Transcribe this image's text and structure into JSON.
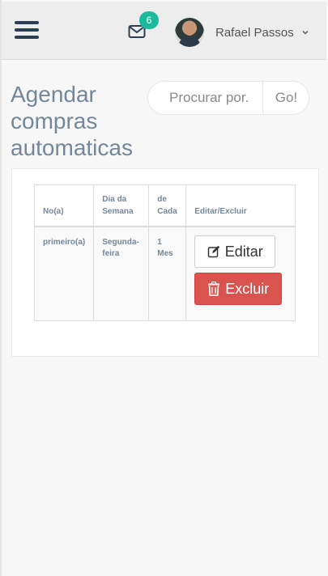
{
  "header": {
    "mail_count": "6",
    "user_name": "Rafael Passos"
  },
  "page": {
    "title": "Agendar compras automaticas"
  },
  "search": {
    "placeholder": "Procurar por.",
    "go_label": "Go!"
  },
  "table": {
    "headers": [
      "No(a)",
      "Dia da Semana",
      "de Cada",
      "Editar/Excluir"
    ],
    "rows": [
      {
        "name": "primeiro(a)",
        "weekday": "Segunda-feira",
        "every": "1 Mes",
        "edit_label": "Editar",
        "delete_label": "Excluir"
      }
    ]
  },
  "colors": {
    "accent": "#1abb9c",
    "danger": "#d9534f",
    "text_muted": "#73879c",
    "nav_icon": "#2a3f54"
  },
  "icons": [
    "menu-icon",
    "envelope-icon",
    "chevron-down-icon",
    "edit-icon",
    "trash-icon"
  ]
}
